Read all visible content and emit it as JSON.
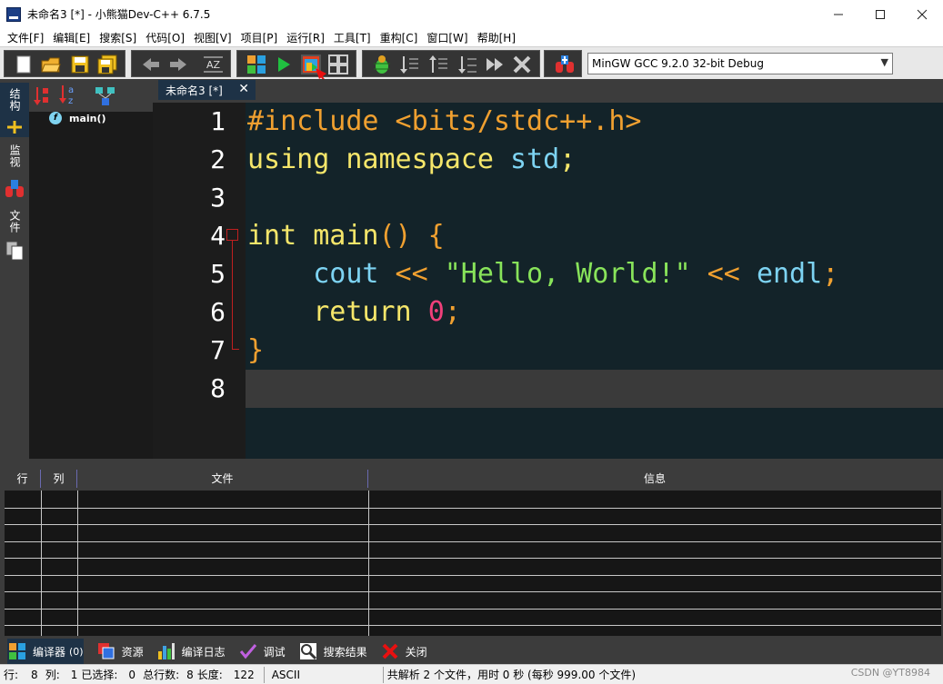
{
  "window": {
    "title": "未命名3 [*] - 小熊猫Dev-C++ 6.7.5",
    "minimize_icon": "minimize-icon",
    "maximize_icon": "maximize-icon",
    "close_icon": "close-icon"
  },
  "menu": [
    "文件[F]",
    "编辑[E]",
    "搜索[S]",
    "代码[O]",
    "视图[V]",
    "项目[P]",
    "运行[R]",
    "工具[T]",
    "重构[C]",
    "窗口[W]",
    "帮助[H]"
  ],
  "toolbar": {
    "compiler_select": "MinGW GCC 9.2.0 32-bit Debug",
    "colors": {
      "background": "#e8e8e8",
      "group": "#343434"
    }
  },
  "side_tabs": [
    "结构",
    "监视",
    "文件"
  ],
  "class_browser": {
    "items": [
      "main()"
    ]
  },
  "editor": {
    "tab_label": "未命名3 [*]",
    "tab_close": "✕",
    "line_numbers": [
      "1",
      "2",
      "3",
      "4",
      "5",
      "6",
      "7",
      "8"
    ],
    "lines": [
      [
        {
          "t": "#include <bits/stdc++.h>",
          "c": "k-orange"
        }
      ],
      [
        {
          "t": "using namespace ",
          "c": "k-yellow"
        },
        {
          "t": "std",
          "c": "k-blue"
        },
        {
          "t": ";",
          "c": "k-yellow"
        }
      ],
      [],
      [
        {
          "t": "int main",
          "c": "k-yellow"
        },
        {
          "t": "() {",
          "c": "k-orange"
        }
      ],
      [
        {
          "t": "    ",
          "c": "k-white"
        },
        {
          "t": "cout",
          "c": "k-blue"
        },
        {
          "t": " << ",
          "c": "k-orange"
        },
        {
          "t": "\"Hello, World!\"",
          "c": "k-green"
        },
        {
          "t": " << ",
          "c": "k-orange"
        },
        {
          "t": "endl",
          "c": "k-blue"
        },
        {
          "t": ";",
          "c": "k-orange"
        }
      ],
      [
        {
          "t": "    ",
          "c": "k-white"
        },
        {
          "t": "return ",
          "c": "k-yellow"
        },
        {
          "t": "0",
          "c": "k-pink"
        },
        {
          "t": ";",
          "c": "k-orange"
        }
      ],
      [
        {
          "t": "}",
          "c": "k-orange"
        }
      ],
      []
    ],
    "colors": {
      "background": "#132329",
      "current_line": "#3a3a3a"
    }
  },
  "messages": {
    "headers": [
      "行",
      "列",
      "文件",
      "信息"
    ]
  },
  "bottom_tabs": [
    {
      "label": "编译器",
      "count": "(0)",
      "icon": "compiler-grid-icon"
    },
    {
      "label": "资源",
      "icon": "resources-icon"
    },
    {
      "label": "编译日志",
      "icon": "bar-chart-icon"
    },
    {
      "label": "调试",
      "icon": "check-icon"
    },
    {
      "label": "搜索结果",
      "icon": "search-icon"
    },
    {
      "label": "关闭",
      "icon": "close-x-icon"
    }
  ],
  "status": {
    "row_label": "行:",
    "row_value": "8",
    "col_label": "列:",
    "col_value": "1",
    "sel_label": "已选择:",
    "sel_value": "0",
    "total_label": "总行数:",
    "total_value": "8",
    "len_label": "长度:",
    "len_value": "122",
    "encoding": "ASCII",
    "parse_msg": "共解析 2 个文件，用时 0 秒 (每秒 999.00 个文件)"
  },
  "watermark": "CSDN @YT8984"
}
